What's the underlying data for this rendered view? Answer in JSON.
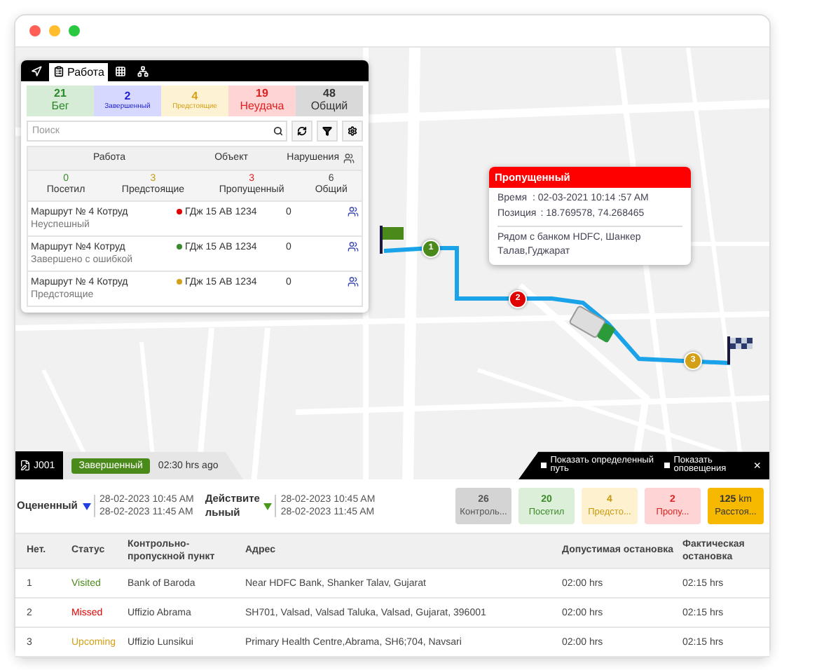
{
  "jobs_panel": {
    "tabs": [
      {
        "selected": false
      },
      {
        "label": "Работа",
        "selected": true
      },
      {
        "selected": false
      },
      {
        "selected": false
      }
    ],
    "summary": [
      {
        "count": "21",
        "label": "Бег",
        "kind": "running"
      },
      {
        "count": "2",
        "label": "Завершенный",
        "kind": "completed"
      },
      {
        "count": "4",
        "label": "Предстоящие",
        "kind": "upcoming"
      },
      {
        "count": "19",
        "label": "Неудача",
        "kind": "failed"
      },
      {
        "count": "48",
        "label": "Общий",
        "kind": "total"
      }
    ],
    "search": {
      "placeholder": "Поиск"
    },
    "columns": [
      "Работа",
      "Объект",
      "Нарушения"
    ],
    "stats": [
      {
        "count": "0",
        "label": "Посетил",
        "kind": "visited"
      },
      {
        "count": "3",
        "label": "Предстоящие",
        "kind": "upcoming"
      },
      {
        "count": "3",
        "label": "Пропущенный",
        "kind": "missed"
      },
      {
        "count": "6",
        "label": "Общий",
        "kind": "total"
      }
    ],
    "rows": [
      {
        "route": "Маршрут № 4 Котруд",
        "status": "Неуспешный",
        "color": "#e00000",
        "object": "ГДж 15 АВ 1234",
        "violations": "0"
      },
      {
        "route": "Маршрут №4 Котруд",
        "status": "Завершено с ошибкой",
        "color": "#3a8a2a",
        "object": "ГДж 15 АВ 1234",
        "violations": "0"
      },
      {
        "route": "Маршрут № 4 Котруд",
        "status": "Предстоящие",
        "color": "#d4a017",
        "object": "ГДж 15 АВ 1234",
        "violations": "0"
      }
    ]
  },
  "popup": {
    "title": "Пропущенный",
    "time_label": "Время",
    "time": ": 02-03-2021 10:14 :57 AM",
    "position_label": "Позиция",
    "position": ": 18.769578, 74.268465",
    "address": "Рядом с банком HDFC, Шанкер Талав,Гуджарат"
  },
  "route_markers": [
    {
      "label": "1",
      "kind": "visited"
    },
    {
      "label": "2",
      "kind": "missed"
    },
    {
      "label": "3",
      "kind": "upcoming"
    }
  ],
  "job_bar": {
    "id": "J001",
    "status": "Завершенный",
    "time": "02:30 hrs ago",
    "options": [
      {
        "label": "Показать определенный путь",
        "checked": false
      },
      {
        "label": "Показать оповещения",
        "checked": false
      }
    ],
    "close": "×"
  },
  "schedule": [
    {
      "label": "Оцененный",
      "kind": "estimated",
      "start": "28-02-2023 10:45 AM",
      "end": "28-02-2023 11:45 AM"
    },
    {
      "label": "Действительный",
      "kind": "actual",
      "start": "28-02-2023 10:45 AM",
      "end": "28-02-2023 11:45 AM"
    }
  ],
  "stats": [
    {
      "value": "26",
      "label": "Контроль...",
      "kind": "checkpoints"
    },
    {
      "value": "20",
      "label": "Посетил",
      "kind": "visited"
    },
    {
      "value": "4",
      "label": "Предсто...",
      "kind": "upcoming"
    },
    {
      "value": "2",
      "label": "Пропу...",
      "kind": "missed"
    },
    {
      "value": "125",
      "unit": "km",
      "label": "Расстоя...",
      "kind": "distance"
    }
  ],
  "checkpoints": {
    "columns": [
      "Нет.",
      "Статус",
      "Контрольно-пропускной пункт",
      "Адрес",
      "Допустимая остановка",
      "Фактическая остановка"
    ],
    "rows": [
      {
        "no": "1",
        "status": "Visited",
        "kind": "visited",
        "checkpoint": "Bank of Baroda",
        "address": "Near HDFC Bank, Shanker Talav, Gujarat",
        "allowed": "02:00 hrs",
        "actual": "02:15 hrs"
      },
      {
        "no": "2",
        "status": "Missed",
        "kind": "missed",
        "checkpoint": "Uffizio Abrama",
        "address": "SH701, Valsad, Valsad Taluka, Valsad, Gujarat, 396001",
        "allowed": "02:00 hrs",
        "actual": "02:15 hrs"
      },
      {
        "no": "3",
        "status": "Upcoming",
        "kind": "upcoming",
        "checkpoint": "Uffizio Lunsikui",
        "address": "Primary Health Centre,Abrama, SH6;704, Navsari",
        "allowed": "02:00 hrs",
        "actual": "02:15 hrs"
      }
    ]
  }
}
